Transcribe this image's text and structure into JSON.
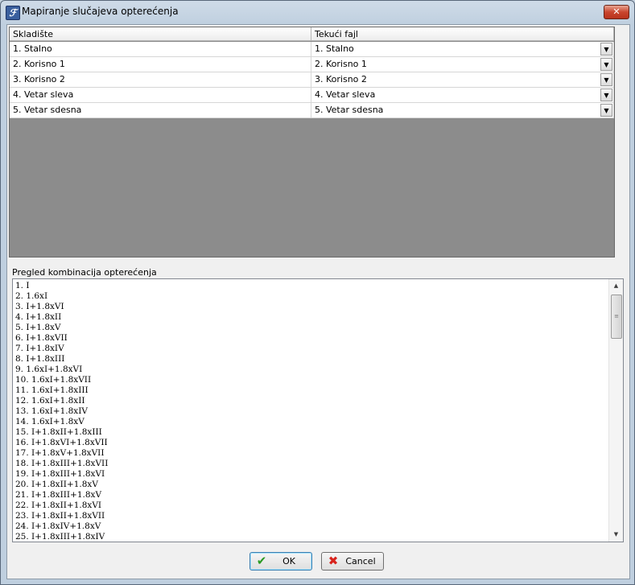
{
  "window": {
    "title": "Mapiranje slučajeva opterećenja",
    "close_label": "✕",
    "app_icon_glyph": "ℱ"
  },
  "grid": {
    "columns": [
      "Skladište",
      "Tekući fajl"
    ],
    "rows": [
      [
        "1. Stalno",
        "1. Stalno"
      ],
      [
        "2. Korisno 1",
        "2. Korisno 1"
      ],
      [
        "3. Korisno 2",
        "3. Korisno 2"
      ],
      [
        "4. Vetar sleva",
        "4. Vetar sleva"
      ],
      [
        "5. Vetar sdesna",
        "5. Vetar sdesna"
      ]
    ],
    "dropdown_glyph": "▼"
  },
  "preview": {
    "label": "Pregled kombinacija opterećenja",
    "items": [
      "1. I",
      "2. 1.6xI",
      "3. I+1.8xVI",
      "4. I+1.8xII",
      "5. I+1.8xV",
      "6. I+1.8xVII",
      "7. I+1.8xIV",
      "8. I+1.8xIII",
      "9. 1.6xI+1.8xVI",
      "10. 1.6xI+1.8xVII",
      "11. 1.6xI+1.8xIII",
      "12. 1.6xI+1.8xII",
      "13. 1.6xI+1.8xIV",
      "14. 1.6xI+1.8xV",
      "15. I+1.8xII+1.8xIII",
      "16. I+1.8xVI+1.8xVII",
      "17. I+1.8xV+1.8xVII",
      "18. I+1.8xIII+1.8xVII",
      "19. I+1.8xIII+1.8xVI",
      "20. I+1.8xII+1.8xV",
      "21. I+1.8xIII+1.8xV",
      "22. I+1.8xII+1.8xVI",
      "23. I+1.8xII+1.8xVII",
      "24. I+1.8xIV+1.8xV",
      "25. I+1.8xIII+1.8xIV"
    ],
    "scroll_up_glyph": "▲",
    "scroll_down_glyph": "▼",
    "scroll_grip_glyph": "≡"
  },
  "buttons": {
    "ok_label": "OK",
    "ok_icon": "✔",
    "cancel_label": "Cancel",
    "cancel_icon": "✖"
  },
  "colors": {
    "grid_background": "#8c8c8c",
    "ok_icon": "#2a9a23",
    "cancel_icon": "#d8231c"
  }
}
